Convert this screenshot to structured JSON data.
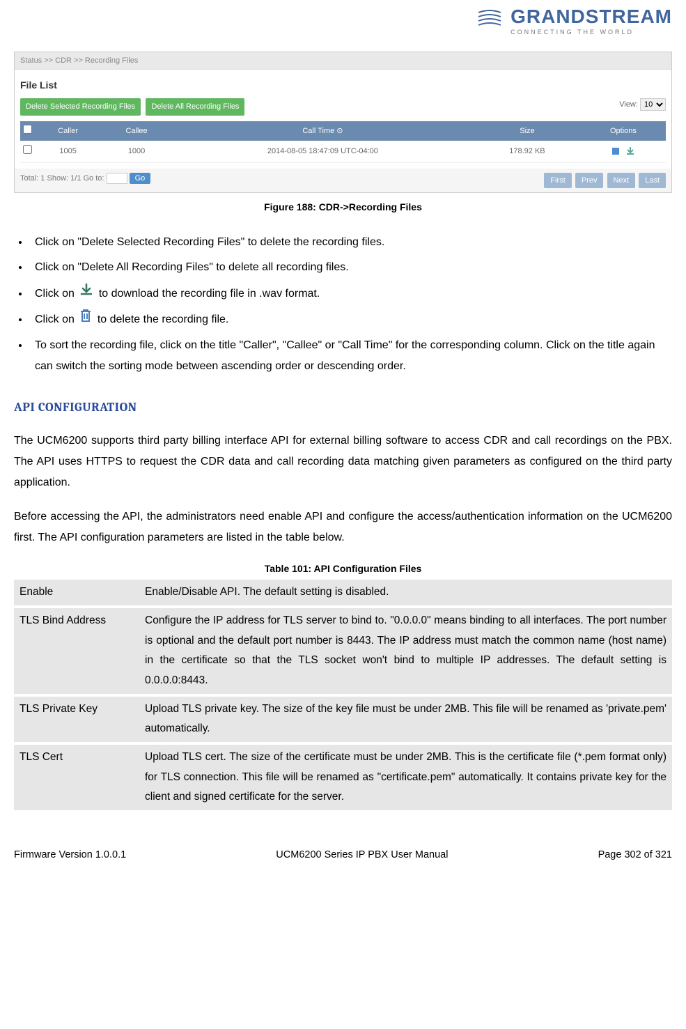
{
  "logo": {
    "name": "GRANDSTREAM",
    "tag": "CONNECTING THE WORLD"
  },
  "screenshot": {
    "breadcrumb": "Status >> CDR >> Recording Files",
    "title": "File List",
    "btn_delete_selected": "Delete Selected Recording Files",
    "btn_delete_all": "Delete All Recording Files",
    "view_label": "View:",
    "view_value": "10",
    "headers": {
      "caller": "Caller",
      "callee": "Callee",
      "calltime": "Call Time ⊙",
      "size": "Size",
      "options": "Options"
    },
    "row": {
      "caller": "1005",
      "callee": "1000",
      "time": "2014-08-05 18:47:09 UTC-04:00",
      "size": "178.92 KB"
    },
    "footer_text": "Total: 1   Show: 1/1   Go to:",
    "go": "Go",
    "pager": {
      "first": "First",
      "prev": "Prev",
      "next": "Next",
      "last": "Last"
    }
  },
  "figure_caption": "Figure 188: CDR->Recording Files",
  "bullets": {
    "b1": "Click on \"Delete Selected Recording Files\" to delete the recording files.",
    "b2": "Click on \"Delete All Recording Files\" to delete all recording files.",
    "b3a": "Click on ",
    "b3b": " to download the recording file in .wav format.",
    "b4a": "Click on ",
    "b4b": " to delete the recording file.",
    "b5": "To sort the recording file, click on the title \"Caller\", \"Callee\" or \"Call Time\" for the corresponding column. Click on the title again can switch the sorting mode between ascending order or descending order."
  },
  "section_heading": "API CONFIGURATION",
  "para1": "The UCM6200 supports third party billing interface API for external billing software to access CDR and call recordings on the PBX. The API uses HTTPS to request the CDR data and call recording data matching given parameters as configured on the third party application.",
  "para2": "Before accessing the API, the administrators need enable API and configure the access/authentication information on the UCM6200 first. The API configuration parameters are listed in the table below.",
  "table_caption": "Table 101: API Configuration Files",
  "table": {
    "r1k": "Enable",
    "r1v": "Enable/Disable API. The default setting is disabled.",
    "r2k": "TLS Bind Address",
    "r2v": "Configure the IP address for TLS server to bind to. \"0.0.0.0\" means binding to all interfaces. The port number is optional and the default port number is 8443. The IP address must match the common name (host name) in the certificate so that the TLS socket won't bind to multiple IP addresses. The default setting is 0.0.0.0:8443.",
    "r3k": "TLS Private Key",
    "r3v": "Upload TLS private key. The size of the key file must be under 2MB. This file will be renamed as 'private.pem' automatically.",
    "r4k": "TLS Cert",
    "r4v": "Upload TLS cert. The size of the certificate must be under 2MB. This is the certificate file (*.pem format only) for TLS connection. This file will be renamed as \"certificate.pem\" automatically. It contains private key for the client and signed certificate for the server."
  },
  "footer": {
    "left": "Firmware Version 1.0.0.1",
    "center": "UCM6200 Series IP PBX User Manual",
    "right": "Page 302 of 321"
  }
}
